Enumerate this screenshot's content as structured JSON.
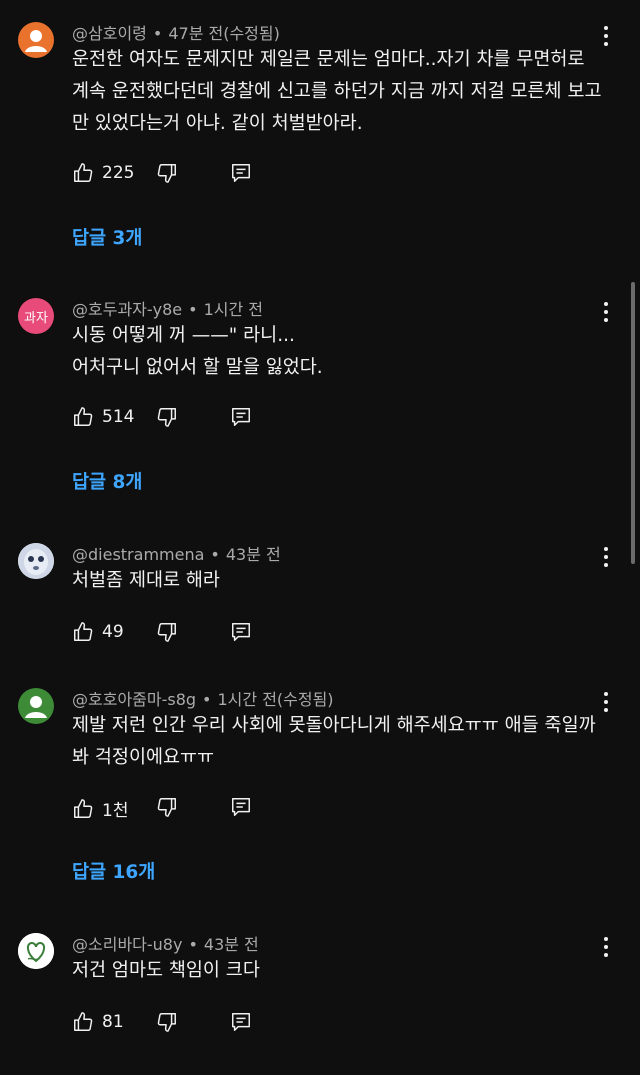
{
  "comments": [
    {
      "author": "@삼호이령",
      "time": "47분 전(수정됨)",
      "text": "운전한 여자도 문제지만 제일큰 문제는 엄마다..자기 차를 무면허로 계속 운전했다던데  경찰에 신고를 하던가 지금 까지 저걸 모른체 보고만 있었다는거 아냐. 같이 처벌받아라.",
      "likes": "225",
      "replies": "답글 3개",
      "avatar": {
        "type": "default",
        "color": "#e9722d"
      }
    },
    {
      "author": "@호두과자-y8e",
      "time": "1시간 전",
      "text": "시동 어떻게 꺼 ——\" 라니...\n어처구니 없어서 할 말을 잃었다.",
      "likes": "514",
      "replies": "답글 8개",
      "avatar": {
        "type": "text",
        "label": "과자",
        "color": "#e84b7a"
      }
    },
    {
      "author": "@diestrammena",
      "time": "43분 전",
      "text": "처벌좀 제대로 해라",
      "likes": "49",
      "replies": "",
      "avatar": {
        "type": "image",
        "color": "#cfd7e6"
      }
    },
    {
      "author": "@호호아줌마-s8g",
      "time": "1시간 전(수정됨)",
      "text": "제발 저런 인간 우리 사회에 못돌아다니게 해주세요ㅠㅠ 애들 죽일까봐 걱정이에요ㅠㅠ",
      "likes": "1천",
      "replies": "답글 16개",
      "avatar": {
        "type": "default",
        "color": "#3d8b37"
      }
    },
    {
      "author": "@소리바다-u8y",
      "time": "43분 전",
      "text": "저건 엄마도 책임이 크다",
      "likes": "81",
      "replies": "",
      "avatar": {
        "type": "image",
        "color": "#ffffff"
      }
    }
  ],
  "icons": {
    "like": "thumbs-up-icon",
    "dislike": "thumbs-down-icon",
    "reply": "reply-icon",
    "more": "more-vertical-icon"
  },
  "colors": {
    "background": "#0f0f0f",
    "link": "#3ea6ff",
    "muted": "#aaaaaa"
  }
}
